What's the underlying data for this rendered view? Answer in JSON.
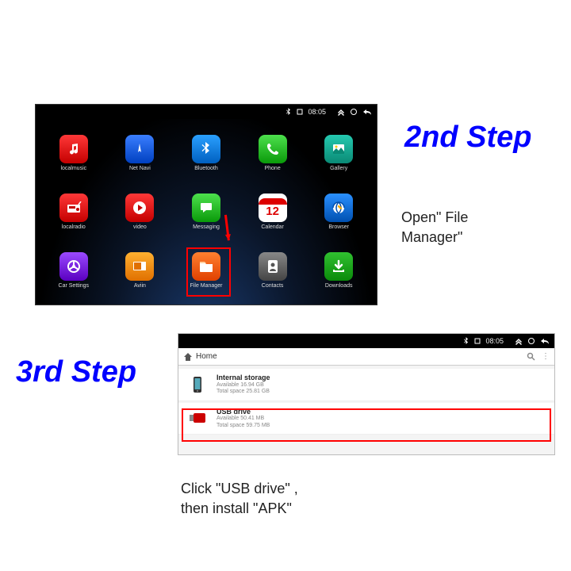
{
  "steps": {
    "step2": {
      "title": "2nd Step",
      "desc_line1": "Open\"  File",
      "desc_line2": "Manager\""
    },
    "step3": {
      "title": "3rd Step",
      "desc_line1": "Click  \"USB drive\"  ,",
      "desc_line2": "then install  \"APK\""
    }
  },
  "statusbar": {
    "time": "08:05"
  },
  "apps": {
    "r0c0": "localmusic",
    "r0c1": "Net Navi",
    "r0c2": "Bluetooth",
    "r0c3": "Phone",
    "r0c4": "Gallery",
    "r1c0": "localradio",
    "r1c1": "video",
    "r1c2": "Messaging",
    "r1c3": "Calendar",
    "r1c4": "Browser",
    "r2c0": "Car Settings",
    "r2c1": "Aviin",
    "r2c2": "File Manager",
    "r2c3": "Contacts",
    "r2c4": "Downloads"
  },
  "calendar_day": "12",
  "filemanager": {
    "breadcrumb": "Home",
    "internal": {
      "title": "Internal storage",
      "avail": "Available 16.94 GB",
      "total": "Total space 25.81 GB"
    },
    "usb": {
      "title": "USB drive",
      "avail": "Available 50.41 MB",
      "total": "Total space 59.75 MB"
    }
  }
}
